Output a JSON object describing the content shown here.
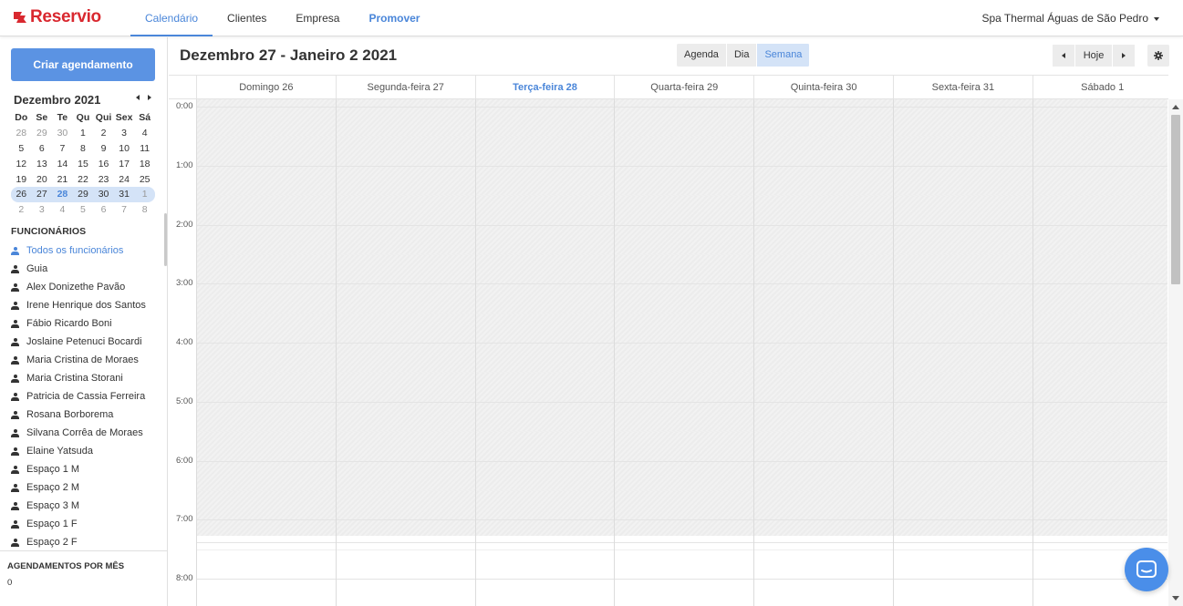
{
  "app": {
    "logo": "Reservio",
    "brand_color": "#d9282f",
    "accent_color": "#4a86d9"
  },
  "nav": {
    "items": [
      "Calendário",
      "Clientes",
      "Empresa",
      "Promover"
    ],
    "active": "Calendário"
  },
  "account": {
    "name": "Spa Thermal Águas de São Pedro"
  },
  "sidebar": {
    "create_button": "Criar agendamento",
    "mini_calendar": {
      "title": "Dezembro 2021",
      "weekdays": [
        "Do",
        "Se",
        "Te",
        "Qu",
        "Qui",
        "Sex",
        "Sá"
      ],
      "weeks": [
        [
          "28",
          "29",
          "30",
          "1",
          "2",
          "3",
          "4"
        ],
        [
          "5",
          "6",
          "7",
          "8",
          "9",
          "10",
          "11"
        ],
        [
          "12",
          "13",
          "14",
          "15",
          "16",
          "17",
          "18"
        ],
        [
          "19",
          "20",
          "21",
          "22",
          "23",
          "24",
          "25"
        ],
        [
          "26",
          "27",
          "28",
          "29",
          "30",
          "31",
          "1"
        ],
        [
          "2",
          "3",
          "4",
          "5",
          "6",
          "7",
          "8"
        ]
      ],
      "selected_week": 4,
      "today": "28"
    },
    "staff_title": "FUNCIONÁRIOS",
    "staff": [
      "Todos os funcionários",
      "Guia",
      "Alex Donizethe Pavão",
      "Irene Henrique dos Santos",
      "Fábio Ricardo Boni",
      "Joslaine Petenuci Bocardi",
      "Maria Cristina de Moraes",
      "Maria Cristina Storani",
      "Patricia de Cassia Ferreira",
      "Rosana Borborema",
      "Silvana Corrêa de Moraes",
      "Elaine Yatsuda",
      "Espaço 1 M",
      "Espaço 2 M",
      "Espaço 3 M",
      "Espaço 1 F",
      "Espaço 2 F"
    ],
    "staff_active": "Todos os funcionários",
    "month_title": "AGENDAMENTOS POR MÊS",
    "month_count": "0"
  },
  "calendar": {
    "title": "Dezembro 27 - Janeiro 2 2021",
    "views": [
      "Agenda",
      "Dia",
      "Semana"
    ],
    "active_view": "Semana",
    "today_button": "Hoje",
    "days": [
      "Domingo 26",
      "Segunda-feira 27",
      "Terça-feira 28",
      "Quarta-feira 29",
      "Quinta-feira 30",
      "Sexta-feira 31",
      "Sábado 1"
    ],
    "today_day": "Terça-feira 28",
    "hours": [
      "0:00",
      "1:00",
      "2:00",
      "3:00",
      "4:00",
      "5:00",
      "6:00",
      "7:00",
      "8:00"
    ]
  }
}
